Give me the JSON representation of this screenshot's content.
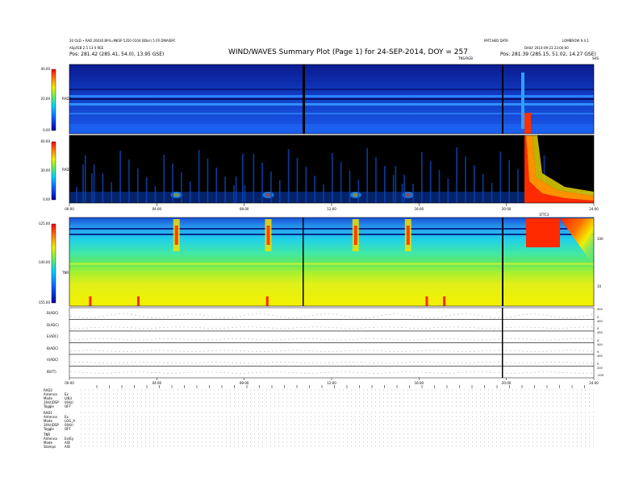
{
  "header": {
    "left_line1": "20 OLD • RAD 20030 BP4=MKSP 5350 0104 (BSkr) 5 FR DMAISPC",
    "left_line2": "ASpFEB 2.5 13 0 REE",
    "pos_left": "Pos:   281.42 (285.41, 54.0), 13.95 GSE)",
    "title": "WIND/WAVES Summary Plot (Page 1) for 24-SEP-2014, DOY = 257",
    "right_line1": "PATCHED DATA",
    "right_line2": "LOMBROW 9.4.1",
    "right_line3": "DAILY 2014-09-23 23:00:00",
    "pos_right": "Pos:   281.39 (285.15, 51.02, 14.27 GSE)",
    "tns_label": "TNS/RGB",
    "corner_mark": "SHS"
  },
  "chart_data": [
    {
      "type": "heatmap",
      "name": "RAD2",
      "title": "",
      "ylabel": "RAD2",
      "ylim": [
        0,
        40
      ],
      "yticks": [
        "0.00",
        "20.00",
        "40.00"
      ],
      "colorbar": [
        "0.00",
        "20.00",
        "40.00"
      ]
    },
    {
      "type": "heatmap",
      "name": "RAD1",
      "ylabel": "RAD1",
      "ylim": [
        0,
        50
      ],
      "yticks": [
        "0.00",
        "30.00",
        "60.00"
      ],
      "colorbar": [
        "0.00",
        "30.00",
        "60.00"
      ],
      "xticks": [
        "00:00",
        "04:00",
        "08:00",
        "12:00",
        "16:00",
        "20:00",
        "24:00"
      ],
      "events_hours": [
        4.9,
        9.1,
        13.1,
        15.5,
        22.0
      ]
    },
    {
      "type": "heatmap",
      "name": "TNR",
      "ylabel": "TNR",
      "ylim": [
        -155,
        -125
      ],
      "yticks": [
        "-155.00",
        "-140.00",
        "-125.00"
      ],
      "right_ticks": [
        "10",
        "100"
      ],
      "inset_label": "1FTC3"
    },
    {
      "type": "line",
      "name": "housekeeping",
      "rows": [
        {
          "label": "B(ADC)",
          "right": [
            "0",
            "200",
            "400"
          ]
        },
        {
          "label": "D(ADC)",
          "right": [
            "0",
            "200",
            "400"
          ]
        },
        {
          "label": "E(ADC)",
          "right": [
            "0",
            "200",
            "400"
          ]
        },
        {
          "label": "B(ADC)",
          "right": [
            "0",
            "200",
            "400"
          ]
        },
        {
          "label": "V(ADC)",
          "right": [
            "0",
            "200",
            "400"
          ]
        },
        {
          "label": "IB(FT)",
          "right": [
            "-200",
            "0",
            "200"
          ]
        }
      ],
      "xticks": [
        "00:00",
        "04:00",
        "08:00",
        "12:00",
        "16:00",
        "20:00",
        "24:00"
      ]
    }
  ],
  "modes": {
    "rad2": {
      "header": "RAD2",
      "rows": [
        {
          "label": "Antenna",
          "val": "Ex"
        },
        {
          "label": "Mode",
          "val": "LIN3"
        },
        {
          "label": "3(Hz)DSP",
          "val": "0(Hz)"
        },
        {
          "label": "Toggle",
          "val": "OFF"
        }
      ]
    },
    "rad1": {
      "header": "RAD1",
      "rows": [
        {
          "label": "Antenna",
          "val": "Ex"
        },
        {
          "label": "Mode",
          "val": "LOG_A"
        },
        {
          "label": "3(Hz)DSP",
          "val": "0(Hz)"
        },
        {
          "label": "Toggle",
          "val": "OFF"
        }
      ]
    },
    "tnr": {
      "header": "TNR",
      "rows": [
        {
          "label": "Antenna",
          "val": "Ex/Ey"
        },
        {
          "label": "Mode",
          "val": "A/B"
        },
        {
          "label": "Stamps",
          "val": "A/B"
        }
      ]
    }
  },
  "colors": {
    "bg_low": "#0a1f9e",
    "bg_mid": "#1a58e0",
    "hot": "#ff2a00",
    "yellow": "#f5f500",
    "green": "#58e858"
  }
}
